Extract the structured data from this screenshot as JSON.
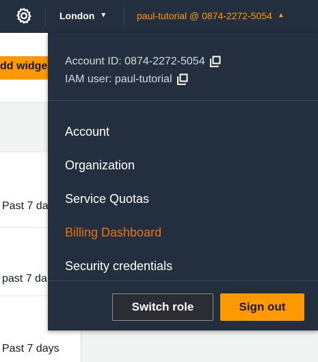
{
  "nav": {
    "region": "London",
    "account_trigger": "paul-tutorial @ 0874-2272-5054"
  },
  "background": {
    "add_widget_label": "dd widge",
    "rows": [
      "Past 7 day",
      "past 7 da",
      "Past 7 days"
    ]
  },
  "dropdown": {
    "account_id": "Account ID: 0874-2272-5054",
    "iam_user": "IAM user: paul-tutorial",
    "menu": [
      {
        "label": "Account",
        "active": false
      },
      {
        "label": "Organization",
        "active": false
      },
      {
        "label": "Service Quotas",
        "active": false
      },
      {
        "label": "Billing Dashboard",
        "active": true
      },
      {
        "label": "Security credentials",
        "active": false
      }
    ],
    "switch_role": "Switch role",
    "sign_out": "Sign out"
  },
  "colors": {
    "nav_bg": "#232f3e",
    "accent": "#ff9900",
    "highlight": "#ec7211"
  }
}
